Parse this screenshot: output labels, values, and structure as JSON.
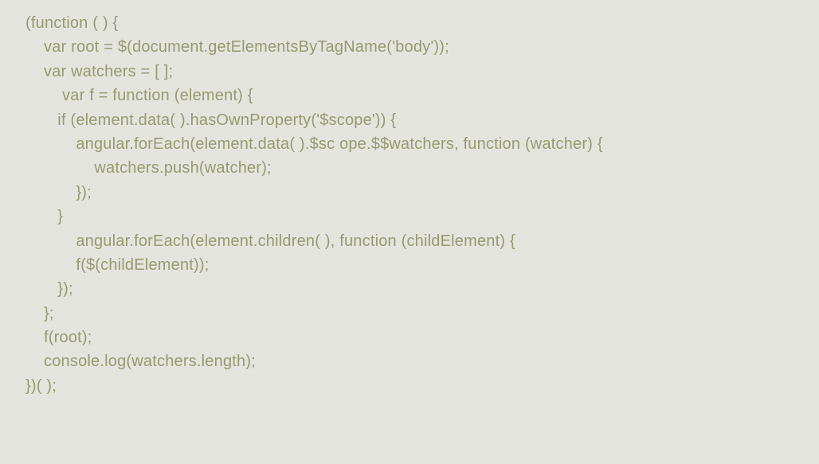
{
  "code": {
    "lines": [
      "(function ( ) {",
      "    var root = $(document.getElementsByTagName('body'));",
      "    var watchers = [ ];",
      "        var f = function (element) {",
      "       if (element.data( ).hasOwnProperty('$scope')) {",
      "           angular.forEach(element.data( ).$sc ope.$$watchers, function (watcher) {",
      "               watchers.push(watcher);",
      "           });",
      "       }",
      "           angular.forEach(element.children( ), function (childElement) {",
      "           f($(childElement));",
      "       });",
      "    };",
      "",
      "    f(root);",
      "",
      "    console.log(watchers.length);",
      "})( );"
    ]
  }
}
